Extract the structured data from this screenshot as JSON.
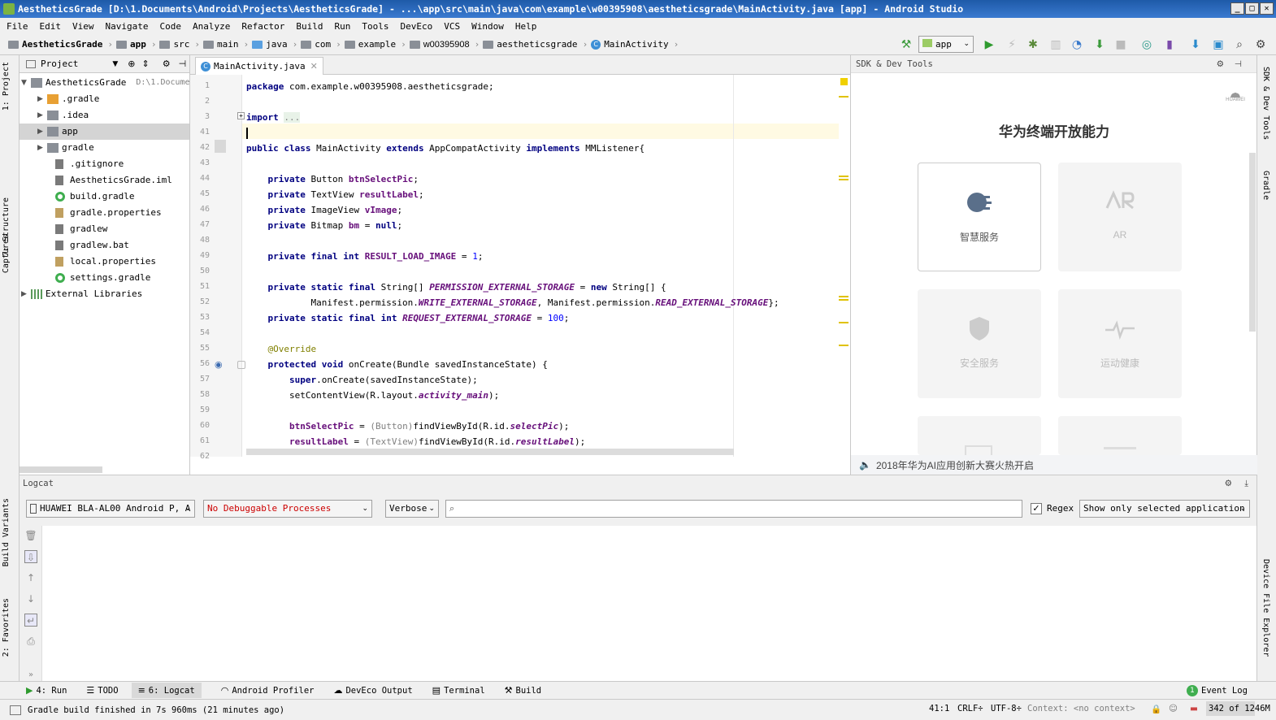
{
  "window": {
    "title": "AestheticsGrade [D:\\1.Documents\\Android\\Projects\\AestheticsGrade] - ...\\app\\src\\main\\java\\com\\example\\w00395908\\aestheticsgrade\\MainActivity.java [app] - Android Studio",
    "min": "_",
    "max": "□",
    "close": "✕"
  },
  "menu": [
    "File",
    "Edit",
    "View",
    "Navigate",
    "Code",
    "Analyze",
    "Refactor",
    "Build",
    "Run",
    "Tools",
    "DevEco",
    "VCS",
    "Window",
    "Help"
  ],
  "breadcrumbs": [
    "AestheticsGrade",
    "app",
    "src",
    "main",
    "java",
    "com",
    "example",
    "w00395908",
    "aestheticsgrade",
    "MainActivity"
  ],
  "toolbar": {
    "run_config": "app"
  },
  "left_strip": {
    "project": "1: Project",
    "structure": "7: Structure",
    "captures": "Captures",
    "build_variants": "Build Variants",
    "favorites": "2: Favorites"
  },
  "right_strip": {
    "sdk": "SDK & Dev Tools",
    "gradle": "Gradle",
    "device_explorer": "Device File Explorer"
  },
  "project_panel": {
    "header": "Project",
    "tree": [
      {
        "label": "AestheticsGrade",
        "hint": "D:\\1.Docume",
        "icon": "module-folder-icon"
      },
      {
        "label": ".gradle",
        "icon": "folder-orange-icon"
      },
      {
        "label": ".idea",
        "icon": "folder-icon"
      },
      {
        "label": "app",
        "icon": "module-folder-icon"
      },
      {
        "label": "gradle",
        "icon": "folder-icon"
      },
      {
        "label": ".gitignore",
        "icon": "file-icon"
      },
      {
        "label": "AestheticsGrade.iml",
        "icon": "file-icon"
      },
      {
        "label": "build.gradle",
        "icon": "gradle-icon"
      },
      {
        "label": "gradle.properties",
        "icon": "properties-icon"
      },
      {
        "label": "gradlew",
        "icon": "file-icon"
      },
      {
        "label": "gradlew.bat",
        "icon": "file-icon"
      },
      {
        "label": "local.properties",
        "icon": "properties-icon"
      },
      {
        "label": "settings.gradle",
        "icon": "gradle-icon"
      },
      {
        "label": "External Libraries",
        "icon": "library-icon"
      }
    ]
  },
  "editor": {
    "tab": "MainActivity.java",
    "line_numbers": [
      "1",
      "2",
      "3",
      "41",
      "42",
      "43",
      "44",
      "45",
      "46",
      "47",
      "48",
      "49",
      "50",
      "51",
      "52",
      "53",
      "54",
      "55",
      "56",
      "57",
      "58",
      "59",
      "60",
      "61",
      "62"
    ]
  },
  "sdk_panel": {
    "header": "SDK & Dev Tools",
    "brand": "HUAWEI",
    "title": "华为终端开放能力",
    "cards": [
      {
        "label": "智慧服务"
      },
      {
        "label": "AR"
      },
      {
        "label": "安全服务"
      },
      {
        "label": "运动健康"
      }
    ],
    "news": "2018年华为AI应用创新大赛火热开启"
  },
  "logcat": {
    "header": "Logcat",
    "device": "HUAWEI BLA-AL00 Android P, A",
    "process": "No Debuggable Processes",
    "level": "Verbose",
    "search_placeholder": "",
    "regex_label": "Regex",
    "filter": "Show only selected application"
  },
  "bottom_tabs": {
    "run": "4: Run",
    "todo": "TODO",
    "logcat": "6: Logcat",
    "profiler": "Android Profiler",
    "deveco": "DevEco Output",
    "terminal": "Terminal",
    "build": "Build",
    "event_log": "Event Log",
    "event_count": "1"
  },
  "status": {
    "message": "Gradle build finished in 7s 960ms (21 minutes ago)",
    "position": "41:1",
    "line_sep": "CRLF÷",
    "encoding": "UTF-8÷",
    "context": "Context: <no context>",
    "memory": "342 of 1246M"
  }
}
